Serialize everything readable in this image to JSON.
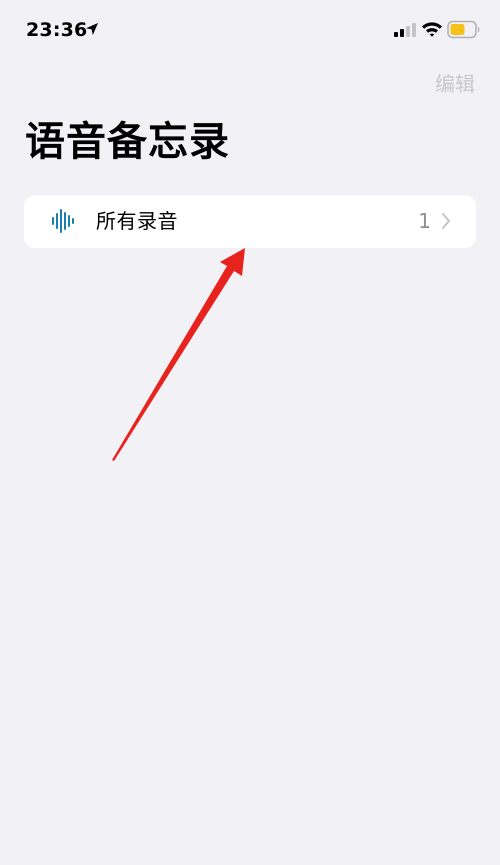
{
  "status_bar": {
    "time": "23:36",
    "accent_battery_color": "#f5c21a"
  },
  "header": {
    "edit_label": "编辑",
    "title": "语音备忘录"
  },
  "list": {
    "items": [
      {
        "label": "所有录音",
        "count": "1",
        "icon": "waveform-icon"
      }
    ]
  },
  "colors": {
    "background": "#f2f1f6",
    "accent_blue": "#1a7fb0",
    "annotation_red": "#e8231e"
  }
}
